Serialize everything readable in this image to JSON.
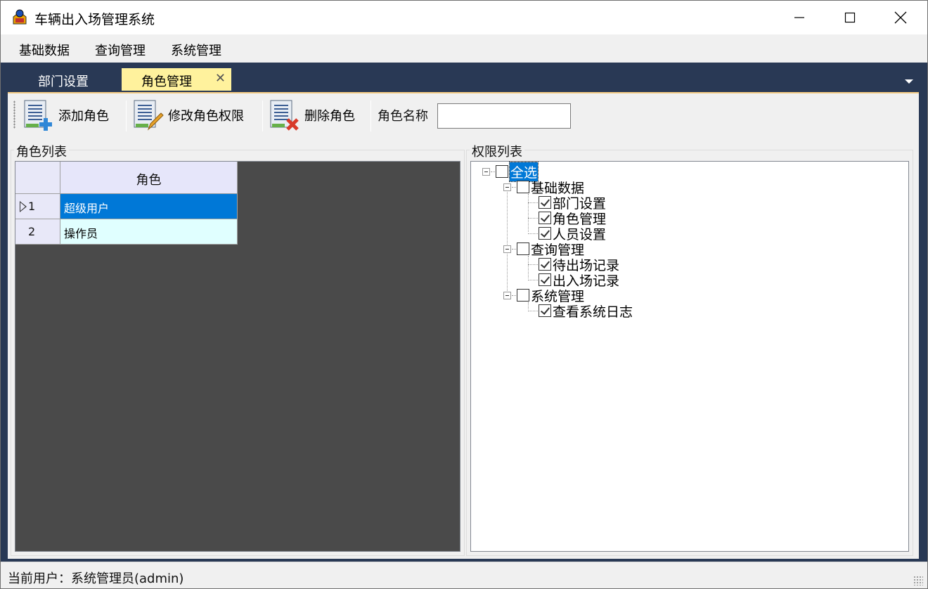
{
  "window": {
    "title": "车辆出入场管理系统"
  },
  "menu": {
    "items": [
      "基础数据",
      "查询管理",
      "系统管理"
    ]
  },
  "tabs": [
    {
      "label": "部门设置",
      "active": false
    },
    {
      "label": "角色管理",
      "active": true,
      "close": "✕"
    }
  ],
  "toolbar": {
    "add_label": "添加角色",
    "edit_label": "修改角色权限",
    "delete_label": "删除角色",
    "role_name_label": "角色名称",
    "role_name_value": ""
  },
  "role_list": {
    "title": "角色列表",
    "column_header": "角色",
    "rows": [
      {
        "num": "1",
        "name": "超级用户",
        "selected": true
      },
      {
        "num": "2",
        "name": "操作员",
        "selected": false
      }
    ]
  },
  "permissions": {
    "title": "权限列表",
    "root": {
      "label": "全选",
      "checked": false
    },
    "groups": [
      {
        "label": "基础数据",
        "checked": false,
        "items": [
          {
            "label": "部门设置",
            "checked": true
          },
          {
            "label": "角色管理",
            "checked": true
          },
          {
            "label": "人员设置",
            "checked": true
          }
        ]
      },
      {
        "label": "查询管理",
        "checked": false,
        "items": [
          {
            "label": "待出场记录",
            "checked": true
          },
          {
            "label": "出入场记录",
            "checked": true
          }
        ]
      },
      {
        "label": "系统管理",
        "checked": false,
        "items": [
          {
            "label": "查看系统日志",
            "checked": true
          }
        ]
      }
    ]
  },
  "status": {
    "text": "当前用户：系统管理员(admin)"
  },
  "colors": {
    "accent": "#0078d7",
    "tab_active": "#fff29d",
    "dark_frame": "#293955",
    "grid_bg": "#4a4a4a"
  }
}
